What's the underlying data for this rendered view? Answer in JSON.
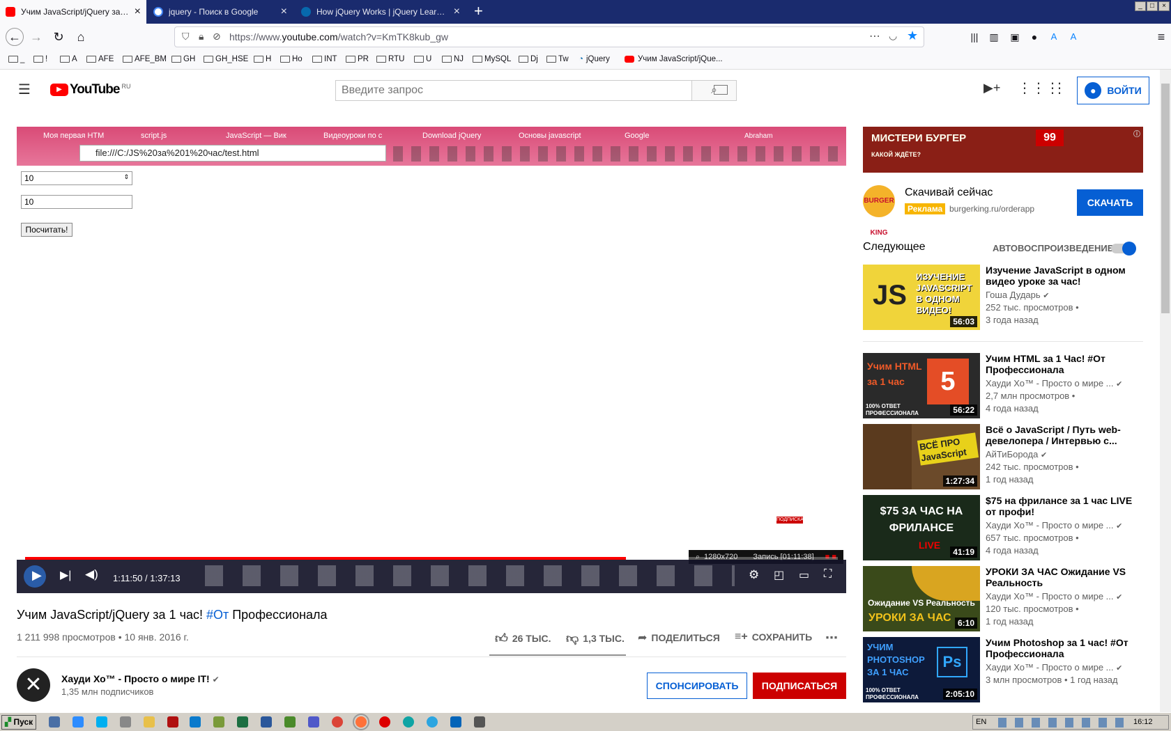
{
  "browser": {
    "tabs": [
      {
        "label": "Учим JavaScript/jQuery за 1 час!",
        "color": "#ff0000",
        "active": true
      },
      {
        "label": "jquery - Поиск в Google",
        "color": "#4285f4",
        "active": false
      },
      {
        "label": "How jQuery Works | jQuery Learning",
        "color": "#0769ad",
        "active": false
      }
    ],
    "url_prefix": "https://www.",
    "url_host": "youtube.com",
    "url_path": "/watch?v=KmTK8kub_gw",
    "bookmarks": [
      "_",
      "!",
      "A",
      "AFE",
      "AFE_BM",
      "GH",
      "GH_HSE",
      "H",
      "Ho",
      "INT",
      "PR",
      "RTU",
      "U",
      "NJ",
      "MySQL",
      "Dj",
      "Tw",
      "jQuery",
      "Учим JavaScript/jQue..."
    ]
  },
  "youtube": {
    "logo_text": "YouTube",
    "logo_region": "RU",
    "search_placeholder": "Введите запрос",
    "signin_label": "ВОЙТИ"
  },
  "player": {
    "inner_tabs": [
      "Моя первая HTM",
      "script.js",
      "JavaScript — Вик",
      "Видеоуроки по с",
      "Download jQuery",
      "Основы javascript",
      "Google"
    ],
    "inner_user": "Abraham",
    "inner_url": "file:///C:/JS%20за%201%20час/test.html",
    "select_value": "10",
    "input_value": "10",
    "calc_button": "Посчитать!",
    "time_current": "1:11:50",
    "time_total": "1:37:13",
    "progress": 0.739,
    "record_resolution": "1280x720",
    "record_label": "Запись [01:11:38]",
    "subscribe_tag": "ПОДПИСКА"
  },
  "video": {
    "title_start": "Учим JavaScript/jQuery за 1 час! ",
    "title_hashtag": "#От",
    "title_end": " Профессионала",
    "meta": "1 211 998 просмотров • 10 янв. 2016 г.",
    "likes": "26 ТЫС.",
    "dislikes": "1,3 ТЫС.",
    "share": "ПОДЕЛИТЬСЯ",
    "save": "СОХРАНИТЬ",
    "channel": "Хауди Хо™ - Просто о мире IT!",
    "subscribers": "1,35 млн подписчиков",
    "sponsor_btn": "СПОНСИРОВАТЬ",
    "subscribe_btn": "ПОДПИСАТЬСЯ"
  },
  "ad": {
    "banner_text": "МИСТЕРИ БУРГЕР",
    "banner_sub": "КАКОЙ ЖДЁТЕ?",
    "banner_price": "99",
    "logo_text": "BURGER KING",
    "title": "Скачивай сейчас",
    "label": "Реклама",
    "url": "burgerking.ru/orderapp",
    "button": "СКАЧАТЬ"
  },
  "sidebar": {
    "next_label": "Следующее",
    "autoplay_label": "АВТОВОСПРОИЗВЕДЕНИЕ",
    "videos": [
      {
        "title": "Изучение JavaScript в одном видео уроке за час!",
        "channel": "Гоша Дударь",
        "views": "252 тыс. просмотров •",
        "age": "3 года назад",
        "duration": "56:03",
        "thumb_text": "JS",
        "thumb_caption": "ИЗУЧЕНИЕ JAVASCRIPT В ОДНОМ ВИДЕО!",
        "thumb_bg": "#f0d43a"
      },
      {
        "title": "Учим HTML за 1 Час! #От Профессионала",
        "channel": "Хауди Хо™ - Просто о мире ...",
        "views": "2,7 млн просмотров •",
        "age": "4 года назад",
        "duration": "56:22",
        "thumb_text": "Учим HTML за 1 час",
        "thumb_caption": "100% ОТВЕТ ПРОФЕССИОНАЛА",
        "thumb_bg": "#2a2a2a"
      },
      {
        "title": "Всё о JavaScript / Путь web-девелопера / Интервью с...",
        "channel": "АйТиБорода",
        "views": "242 тыс. просмотров •",
        "age": "1 год назад",
        "duration": "1:27:34",
        "thumb_text": "ВСЁ ПРО JavaScript",
        "thumb_caption": "",
        "thumb_bg": "#6b4a2a"
      },
      {
        "title": "$75 на фрилансе за 1 час LIVE от профи!",
        "channel": "Хауди Хо™ - Просто о мире ...",
        "views": "657 тыс. просмотров •",
        "age": "4 года назад",
        "duration": "41:19",
        "thumb_text": "$75 ЗА ЧАС НА ФРИЛАНСЕ",
        "thumb_caption": "LIVE",
        "thumb_bg": "#1a2a1a"
      },
      {
        "title": "УРОКИ ЗА ЧАС Ожидание VS Реальность",
        "channel": "Хауди Хо™ - Просто о мире ...",
        "views": "120 тыс. просмотров •",
        "age": "1 год назад",
        "duration": "6:10",
        "thumb_text": "Ожидание VS Реальность",
        "thumb_caption": "УРОКИ ЗА ЧАС",
        "thumb_bg": "#3a4a1a"
      },
      {
        "title": "Учим Photoshop за 1 час! #От Профессионала",
        "channel": "Хауди Хо™ - Просто о мире ...",
        "views": "3 млн просмотров • 1 год назад",
        "age": "",
        "duration": "2:05:10",
        "thumb_text": "УЧИМ PHOTOSHOP ЗА 1 ЧАС",
        "thumb_caption": "100% ОТВЕТ ПРОФЕССИОНАЛА",
        "thumb_bg": "#0d1a3a"
      }
    ]
  },
  "taskbar": {
    "start_label": "Пуск",
    "lang": "EN",
    "clock": "16:12"
  }
}
